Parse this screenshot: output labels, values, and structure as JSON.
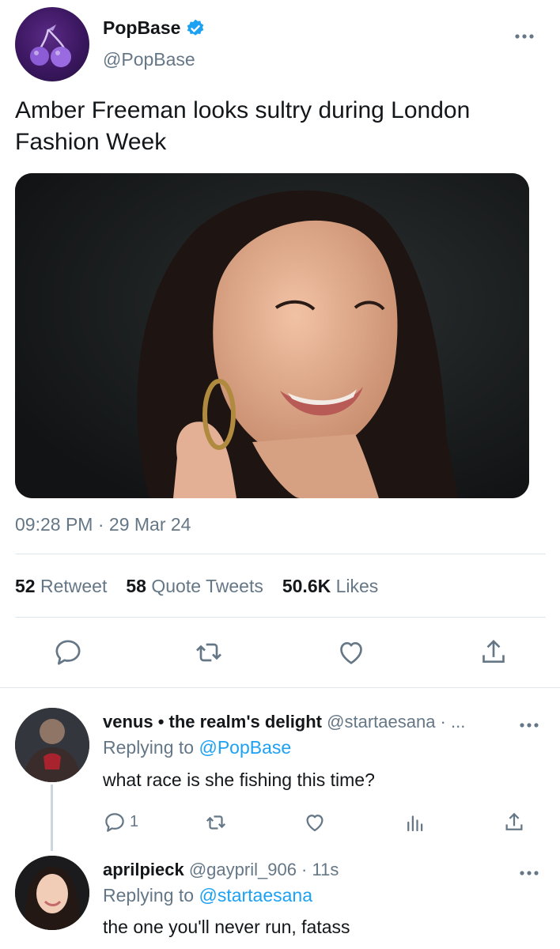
{
  "tweet": {
    "display_name": "PopBase",
    "handle": "@PopBase",
    "text": "Amber Freeman looks sultry during London Fashion Week",
    "time": "09:28 PM",
    "date_sep": " · ",
    "date": "29 Mar 24",
    "stats": {
      "retweets_count": "52",
      "retweets_label": "Retweet",
      "quotes_count": "58",
      "quotes_label": "Quote Tweets",
      "likes_count": "50.6K",
      "likes_label": "Likes"
    }
  },
  "replies": [
    {
      "display_name": "venus • the realm's delight",
      "handle": "@startaesana",
      "meta": " · ...",
      "replying_prefix": "Replying to ",
      "replying_to": "@PopBase",
      "text": "what race is she fishing this time?",
      "reply_count": "1"
    },
    {
      "display_name": "aprilpieck",
      "handle": "@gaypril_906",
      "meta": " · 11s",
      "replying_prefix": "Replying to ",
      "replying_to": "@startaesana",
      "text": "the one you'll never run, fatass"
    }
  ],
  "icons": {
    "verified": "verified-badge-icon",
    "more": "more-options-icon",
    "reply": "reply-icon",
    "retweet": "retweet-icon",
    "like": "heart-icon",
    "share": "share-icon",
    "analytics": "analytics-icon"
  },
  "colors": {
    "accent": "#1da1f2",
    "secondary_text": "#657786",
    "primary_text": "#14171a",
    "divider": "#e1e8ed"
  }
}
